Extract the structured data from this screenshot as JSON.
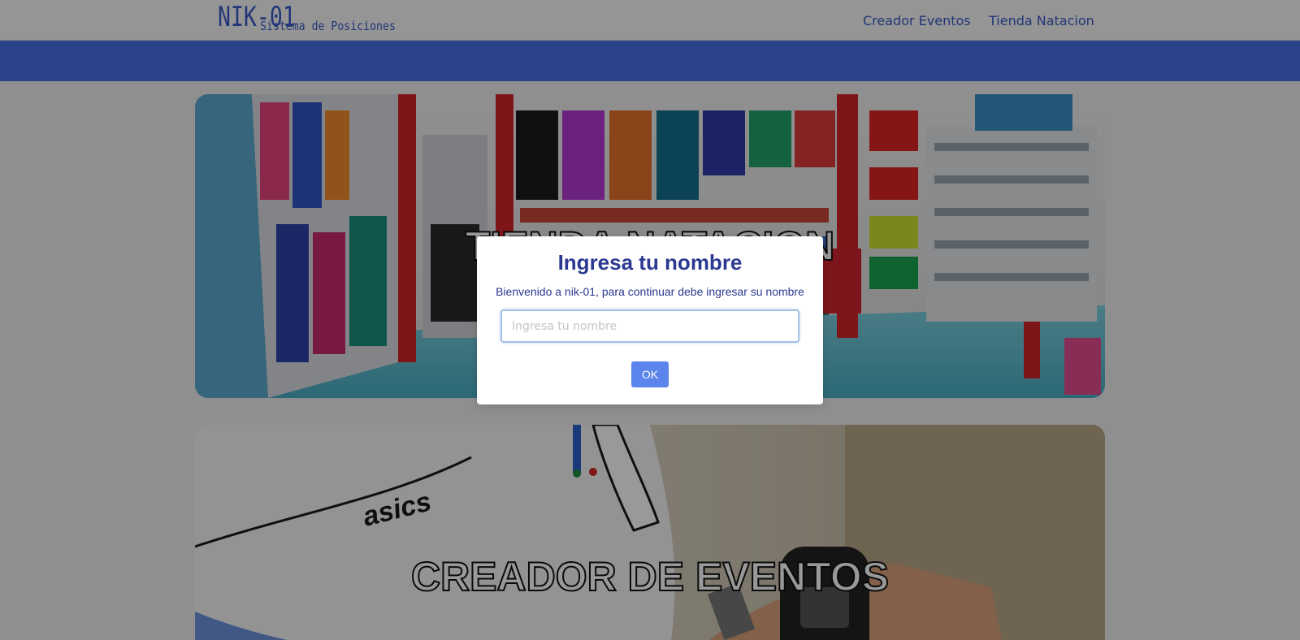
{
  "header": {
    "logo_main": "NIK-01",
    "logo_sub": "Sistema de Posiciones",
    "nav": {
      "creador": "Creador Eventos",
      "tienda": "Tienda Natacion"
    }
  },
  "colors": {
    "accent": "#4970e8",
    "link": "#3a5cc7",
    "modal_text": "#2b3990",
    "ok_button": "#5b84ec"
  },
  "cards": {
    "tienda_title": "TIENDA NATACION",
    "creador_title": "CREADOR DE EVENTOS"
  },
  "modal": {
    "title": "Ingresa tu nombre",
    "message": "Bienvenido a nik-01, para continuar debe ingresar su nombre",
    "input_placeholder": "Ingresa tu nombre",
    "ok_label": "OK"
  }
}
